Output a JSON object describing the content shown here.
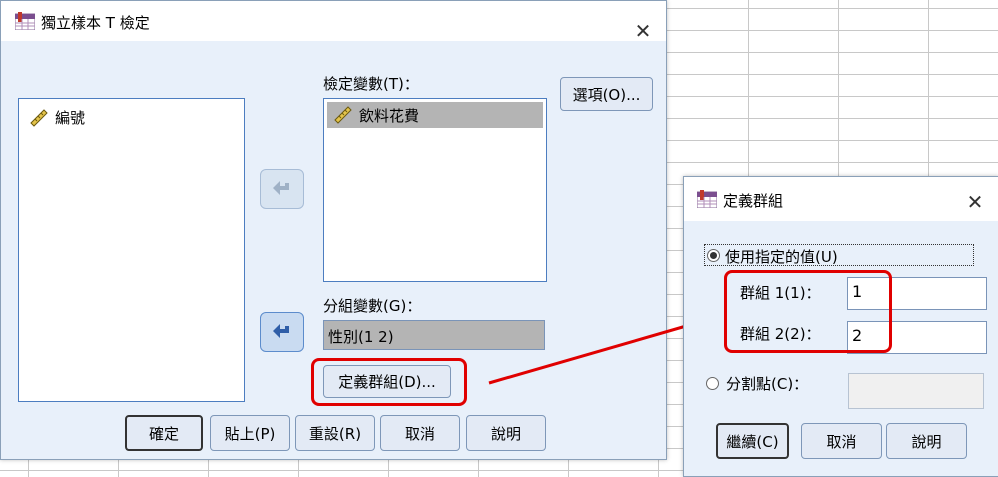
{
  "main_dialog": {
    "title": "獨立樣本 T 檢定",
    "source_list": {
      "items": [
        "編號"
      ]
    },
    "test_vars": {
      "label": "檢定變數(T)：",
      "items": [
        "飲料花費"
      ]
    },
    "group_var": {
      "label": "分組變數(G)：",
      "value": "性別(1 2)"
    },
    "buttons": {
      "options": "選項(O)...",
      "define_groups": "定義群組(D)...",
      "ok": "確定",
      "paste": "貼上(P)",
      "reset": "重設(R)",
      "cancel": "取消",
      "help": "說明"
    }
  },
  "define_dialog": {
    "title": "定義群組",
    "radio_specified": "使用指定的值(U)",
    "group1_label": "群組 1(1)：",
    "group1_value": "1",
    "group2_label": "群組 2(2)：",
    "group2_value": "2",
    "radio_cutpoint": "分割點(C)：",
    "cutpoint_value": "",
    "buttons": {
      "continue": "繼續(C)",
      "cancel": "取消",
      "help": "說明"
    }
  },
  "colors": {
    "annotation": "#e00000",
    "dialog_bg": "#e8f0fa",
    "selection": "#b4b4b4"
  },
  "icons": [
    "spss-app-icon",
    "ruler-scale-icon",
    "arrow-left-icon",
    "close-icon"
  ]
}
